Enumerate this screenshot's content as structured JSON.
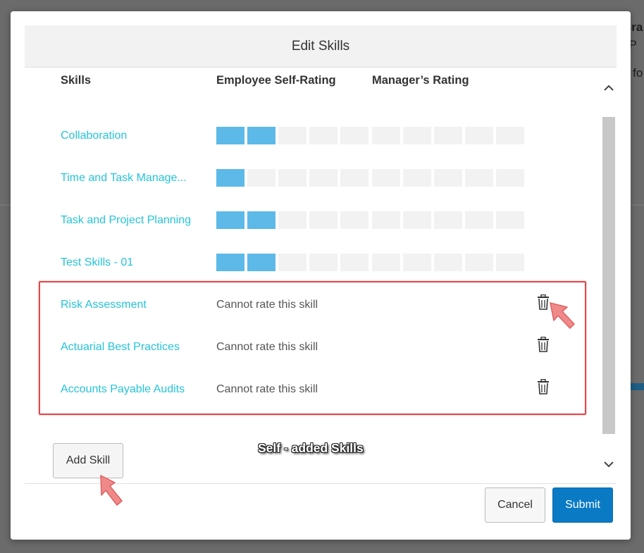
{
  "background": {
    "right_fragments": [
      "Bra",
      "l P",
      "e fo"
    ],
    "accent_color": "#1d5e86"
  },
  "dialog": {
    "title": "Edit Skills",
    "columns": {
      "skills": "Skills",
      "self_rating": "Employee Self-Rating",
      "manager_rating": "Manager’s Rating"
    },
    "rated_skills": [
      {
        "name": "Collaboration",
        "self_rating": 2,
        "manager_rating": 0
      },
      {
        "name": "Time and Task Manage...",
        "self_rating": 1,
        "manager_rating": 0
      },
      {
        "name": "Task and Project Planning",
        "self_rating": 2,
        "manager_rating": 0
      },
      {
        "name": "Test Skills - 01",
        "self_rating": 2,
        "manager_rating": 0
      }
    ],
    "rating_scale_max": 5,
    "self_added_skills": [
      {
        "name": "Risk Assessment",
        "status": "Cannot rate this skill",
        "icon": "trash-icon"
      },
      {
        "name": "Actuarial Best Practices",
        "status": "Cannot rate this skill",
        "icon": "trash-icon"
      },
      {
        "name": "Accounts Payable Audits",
        "status": "Cannot rate this skill",
        "icon": "trash-icon"
      }
    ],
    "annotation": "Self - added Skills",
    "add_skill_label": "Add Skill",
    "cancel_label": "Cancel",
    "submit_label": "Submit"
  },
  "colors": {
    "skill_link": "#25c4d8",
    "rating_on": "#5cb9e8",
    "rating_off": "#f2f2f2",
    "submit": "#0a7ac5",
    "highlight": "#e04848"
  }
}
